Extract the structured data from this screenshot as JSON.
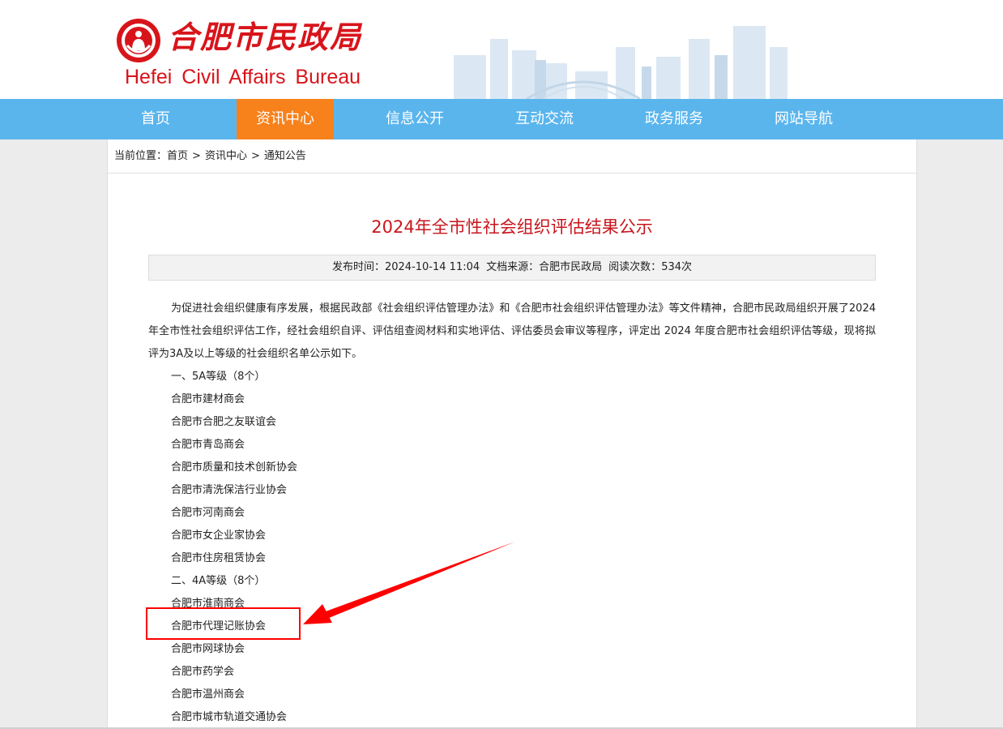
{
  "brand": {
    "name_cn": "合肥市民政局",
    "name_en": "Hefei Civil Affairs Bureau",
    "color": "#d8141b"
  },
  "nav": {
    "items": [
      {
        "label": "首页",
        "active": false
      },
      {
        "label": "资讯中心",
        "active": true
      },
      {
        "label": "信息公开",
        "active": false
      },
      {
        "label": "互动交流",
        "active": false
      },
      {
        "label": "政务服务",
        "active": false
      },
      {
        "label": "网站导航",
        "active": false
      }
    ],
    "bg_color": "#5ab5ed",
    "active_color": "#f7811b"
  },
  "breadcrumb": {
    "prefix": "当前位置：",
    "items": [
      "首页",
      "资讯中心",
      "通知公告"
    ],
    "separator": ">"
  },
  "article": {
    "title": "2024年全市性社会组织评估结果公示",
    "meta": {
      "published_label": "发布时间：",
      "published": "2024-10-14 11:04",
      "source_label": "文档来源：",
      "source": "合肥市民政局",
      "views_label": "阅读次数：",
      "views": "534次"
    },
    "intro": "为促进社会组织健康有序发展，根据民政部《社会组织评估管理办法》和《合肥市社会组织评估管理办法》等文件精神，合肥市民政局组织开展了2024年全市性社会组织评估工作，经社会组织自评、评估组查阅材料和实地评估、评估委员会审议等程序，评定出 2024 年度合肥市社会组织评估等级，现将拟评为3A及以上等级的社会组织名单公示如下。",
    "list": [
      "一、5A等级（8个）",
      "合肥市建材商会",
      "合肥市合肥之友联谊会",
      "合肥市青岛商会",
      "合肥市质量和技术创新协会",
      "合肥市清洗保洁行业协会",
      "合肥市河南商会",
      "合肥市女企业家协会",
      "合肥市住房租赁协会",
      "二、4A等级（8个）",
      "合肥市淮南商会",
      "合肥市代理记账协会",
      "合肥市网球协会",
      "合肥市药学会",
      "合肥市温州商会",
      "合肥市城市轨道交通协会"
    ]
  },
  "annotation": {
    "highlighted_item": "合肥市代理记账协会",
    "color": "#ff0000"
  }
}
